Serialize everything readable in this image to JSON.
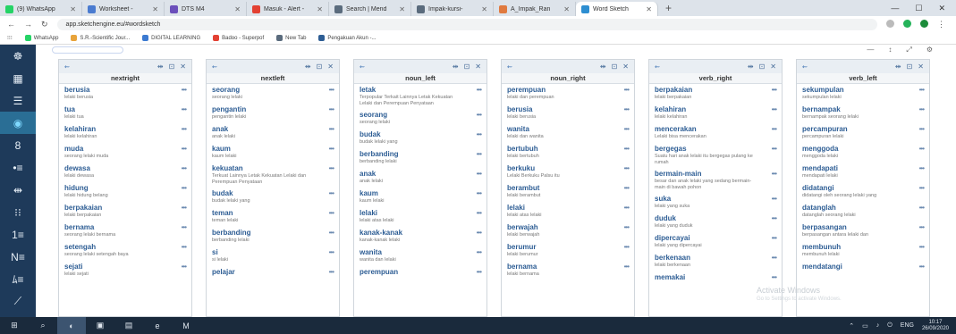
{
  "browser": {
    "tabs": [
      {
        "label": "(9) WhatsApp",
        "color": "#25d366"
      },
      {
        "label": "Worksheet -",
        "color": "#4a7bd0"
      },
      {
        "label": "DTS M4",
        "color": "#6b4fbb"
      },
      {
        "label": "Masuk - Alert -",
        "color": "#e34133"
      },
      {
        "label": "Search | Mend",
        "color": "#5a6b7d"
      },
      {
        "label": "Impak-kursi-",
        "color": "#5a6b7d"
      },
      {
        "label": "A_Impak_Ran",
        "color": "#e07a3f"
      },
      {
        "label": "Word Sketch",
        "color": "#2d8ed1",
        "active": true
      }
    ],
    "new_tab": "+",
    "controls": [
      "—",
      "☐",
      "✕"
    ],
    "url": "app.sketchengine.eu/#wordsketch",
    "bookmarks": [
      {
        "label": "WhatsApp",
        "color": "#25d366"
      },
      {
        "label": "S.R.-Scientific Jour...",
        "color": "#e8a33a"
      },
      {
        "label": "DIGITAL LEARNING",
        "color": "#3b7ad1"
      },
      {
        "label": "Badoo - Superpof",
        "color": "#e34133"
      },
      {
        "label": "New Tab",
        "color": "#5a6b7d"
      },
      {
        "label": "Pengakuan Akun -...",
        "color": "#2d5d94"
      }
    ]
  },
  "sidebar": {
    "items": [
      {
        "icon": "☸",
        "name": "logo-icon"
      },
      {
        "icon": "▦",
        "name": "dashboard-icon"
      },
      {
        "icon": "☰",
        "name": "concordance-icon"
      },
      {
        "icon": "◉",
        "name": "wordsketch-icon",
        "selected": true
      },
      {
        "icon": "8",
        "name": "thesaurus-icon"
      },
      {
        "icon": "•≡",
        "name": "wordlist-icon"
      },
      {
        "icon": "⇹",
        "name": "sketchdiff-icon"
      },
      {
        "icon": "⁝⁝",
        "name": "ngrams-icon"
      },
      {
        "icon": "1≡",
        "name": "keywords-icon"
      },
      {
        "icon": "N≡",
        "name": "trends-icon"
      },
      {
        "icon": "ﾑ≡",
        "name": "parallel-icon"
      },
      {
        "icon": "⟋",
        "name": "edit-icon"
      }
    ]
  },
  "columns": [
    {
      "title": "nextright",
      "items": [
        {
          "word": "berusia",
          "sentence": "lelaki berusia"
        },
        {
          "word": "tua",
          "sentence": "lelaki tua"
        },
        {
          "word": "kelahiran",
          "sentence": "lelaki kelahiran"
        },
        {
          "word": "muda",
          "sentence": "seorang lelaki muda"
        },
        {
          "word": "dewasa",
          "sentence": "lelaki dewasa"
        },
        {
          "word": "hidung",
          "sentence": "lelaki hidung belang"
        },
        {
          "word": "berpakaian",
          "sentence": "lelaki berpakaian"
        },
        {
          "word": "bernama",
          "sentence": "seorang lelaki bernama"
        },
        {
          "word": "setengah",
          "sentence": "seorang lelaki setengah baya"
        },
        {
          "word": "sejati",
          "sentence": "lelaki sejati"
        }
      ]
    },
    {
      "title": "nextleft",
      "items": [
        {
          "word": "seorang",
          "sentence": "seorang lelaki"
        },
        {
          "word": "pengantin",
          "sentence": "pengantin lelaki"
        },
        {
          "word": "anak",
          "sentence": "anak lelaki"
        },
        {
          "word": "kaum",
          "sentence": "kaum lelaki"
        },
        {
          "word": "kekuatan",
          "sentence": "Terkuat Lainnya Letak Kekuatan Lelaki dan Perempuan Penyataan"
        },
        {
          "word": "budak",
          "sentence": "budak lelaki yang"
        },
        {
          "word": "teman",
          "sentence": "teman lelaki"
        },
        {
          "word": "berbanding",
          "sentence": "berbanding lelaki"
        },
        {
          "word": "si",
          "sentence": "si lelaki"
        },
        {
          "word": "pelajar",
          "sentence": ""
        }
      ]
    },
    {
      "title": "noun_left",
      "items": [
        {
          "word": "letak",
          "sentence": "Terpopular Terkait Lainnya Letak Kekuatan Lelaki dan Perempuan Penyataan"
        },
        {
          "word": "seorang",
          "sentence": "seorang lelaki"
        },
        {
          "word": "budak",
          "sentence": "budak lelaki yang"
        },
        {
          "word": "berbanding",
          "sentence": "berbanding lelaki"
        },
        {
          "word": "anak",
          "sentence": "anak lelaki"
        },
        {
          "word": "kaum",
          "sentence": "kaum lelaki"
        },
        {
          "word": "lelaki",
          "sentence": "lelaki atas lelaki"
        },
        {
          "word": "kanak-kanak",
          "sentence": "kanak-kanak lelaki"
        },
        {
          "word": "wanita",
          "sentence": "wanita dan lelaki"
        },
        {
          "word": "perempuan",
          "sentence": ""
        }
      ]
    },
    {
      "title": "noun_right",
      "items": [
        {
          "word": "perempuan",
          "sentence": "lelaki dan perempuan"
        },
        {
          "word": "berusia",
          "sentence": "lelaki berusia"
        },
        {
          "word": "wanita",
          "sentence": "lelaki dan wanita"
        },
        {
          "word": "bertubuh",
          "sentence": "lelaki bertubuh"
        },
        {
          "word": "berkuku",
          "sentence": "Lelaki Berkuku Palsu itu"
        },
        {
          "word": "berambut",
          "sentence": "lelaki berambut"
        },
        {
          "word": "lelaki",
          "sentence": "lelaki atas lelaki"
        },
        {
          "word": "berwajah",
          "sentence": "lelaki berwajah"
        },
        {
          "word": "berumur",
          "sentence": "lelaki berumur"
        },
        {
          "word": "bernama",
          "sentence": "lelaki bernama"
        }
      ]
    },
    {
      "title": "verb_right",
      "items": [
        {
          "word": "berpakaian",
          "sentence": "lelaki berpakaian"
        },
        {
          "word": "kelahiran",
          "sentence": "lelaki kelahiran"
        },
        {
          "word": "mencerakan",
          "sentence": "Lelaki bisa mencerakan"
        },
        {
          "word": "bergegas",
          "sentence": "Suatu hari anak lelaki itu bergegas pulang ke rumah"
        },
        {
          "word": "bermain-main",
          "sentence": "besar dan anak lelaki yang sedang bermain-main di bawah pohon"
        },
        {
          "word": "suka",
          "sentence": "lelaki yang suka"
        },
        {
          "word": "duduk",
          "sentence": "lelaki yang duduk"
        },
        {
          "word": "dipercayai",
          "sentence": "lelaki yang dipercayai"
        },
        {
          "word": "berkenaan",
          "sentence": "lelaki berkenaan"
        },
        {
          "word": "memakai",
          "sentence": ""
        }
      ]
    },
    {
      "title": "verb_left",
      "items": [
        {
          "word": "sekumpulan",
          "sentence": "sekumpulan lelaki"
        },
        {
          "word": "bernampak",
          "sentence": "bernampak seorang lelaki"
        },
        {
          "word": "percampuran",
          "sentence": "percampuran lelaki"
        },
        {
          "word": "menggoda",
          "sentence": "menggoda lelaki"
        },
        {
          "word": "mendapati",
          "sentence": "mendapati lelaki"
        },
        {
          "word": "didatangi",
          "sentence": "didatangi oleh seorang lelaki yang"
        },
        {
          "word": "datanglah",
          "sentence": "datanglah seorang lelaki"
        },
        {
          "word": "berpasangan",
          "sentence": "berpasangan antara lelaki dan"
        },
        {
          "word": "membunuh",
          "sentence": "membunuh lelaki"
        },
        {
          "word": "mendatangi",
          "sentence": ""
        }
      ]
    }
  ],
  "column_tools": {
    "grip": "⇜",
    "tools": [
      "⇹",
      "⊡",
      "✕"
    ]
  },
  "more": "•••",
  "watermark": {
    "title": "Activate Windows",
    "subtitle": "Go to Settings to activate Windows."
  },
  "taskbar": {
    "items": [
      {
        "icon": "⊞",
        "name": "start-icon"
      },
      {
        "icon": "⌕",
        "name": "search-icon"
      },
      {
        "icon": "◐",
        "name": "chrome-icon",
        "active": true
      },
      {
        "icon": "▣",
        "name": "store-icon"
      },
      {
        "icon": "▤",
        "name": "files-icon"
      },
      {
        "icon": "e",
        "name": "edge-icon"
      },
      {
        "icon": "M",
        "name": "mail-icon"
      }
    ],
    "tray": [
      "⌃",
      "▭",
      "♪",
      "⏻",
      "ENG"
    ],
    "time": "10:17",
    "date": "26/09/2020"
  },
  "toolbar_right": [
    "—",
    "↕",
    "⤢",
    "⚙"
  ]
}
